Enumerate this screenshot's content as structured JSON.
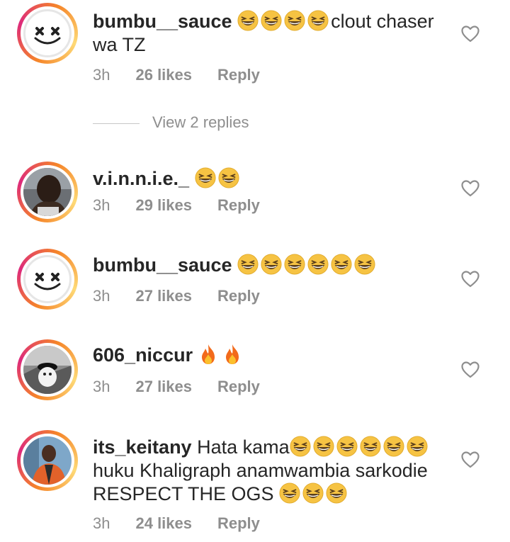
{
  "comments": [
    {
      "username": "bumbu__sauce",
      "text_after_emoji": "clout chaser wa TZ",
      "emoji_count": 4,
      "time": "3h",
      "likes": "26 likes",
      "reply": "Reply",
      "avatar": "marshmello-face"
    },
    {
      "username": "v.i.n.n.i.e._",
      "emoji_count": 2,
      "time": "3h",
      "likes": "29 likes",
      "reply": "Reply",
      "avatar": "photo-person"
    },
    {
      "username": "bumbu__sauce",
      "emoji_count": 6,
      "time": "3h",
      "likes": "27 likes",
      "reply": "Reply",
      "avatar": "marshmello-face"
    },
    {
      "username": "606_niccur",
      "fire_count": 2,
      "time": "3h",
      "likes": "27 likes",
      "reply": "Reply",
      "avatar": "photo-dog"
    },
    {
      "username": "its_keitany",
      "text_line1": "Hata kama",
      "text_line2": "huku Khaligraph anamwambia sarkodie",
      "text_line3": "RESPECT THE OGS",
      "time": "3h",
      "likes": "24 likes",
      "reply": "Reply",
      "avatar": "photo-person-orange"
    }
  ],
  "view_replies": "View 2 replies",
  "colors": {
    "meta_gray": "#8e8e8e",
    "text": "#262626",
    "ring_orange": "#f58529",
    "ring_pink": "#dd2a7b"
  },
  "icons": {
    "like": "heart-outline-icon",
    "laugh": "grinning-squinting-emoji",
    "fire": "fire-emoji"
  }
}
